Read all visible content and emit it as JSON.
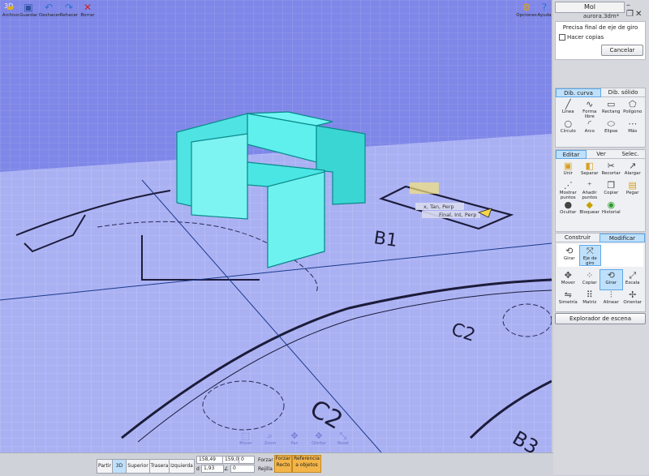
{
  "viewport": {
    "label": "3D",
    "snap_labels": [
      "x, Tan, Perp",
      "Final, Int, Perp"
    ],
    "drawing_labels": [
      "B1",
      "C2",
      "C2",
      "B3"
    ],
    "nav": [
      {
        "icon": "pan-view-icon",
        "label": "Mover"
      },
      {
        "icon": "zoom-icon",
        "label": "Zoom"
      },
      {
        "icon": "pan-icon",
        "label": "Pan"
      },
      {
        "icon": "orbit-icon",
        "label": "Orbitar"
      },
      {
        "icon": "reset-icon",
        "label": "Reset"
      }
    ]
  },
  "panel": {
    "title": "Mol",
    "filename": "aurora.3dm*",
    "prompt": "Precisa final de eje de giro",
    "copy_checkbox": "Hacer copias",
    "cancel": "Cancelar",
    "draw_tabs": [
      "Dib. curva",
      "Dib. sólido"
    ],
    "draw_tools": [
      {
        "icon": "line-icon",
        "label": "Línea"
      },
      {
        "icon": "freeform-icon",
        "label": "Forma libre"
      },
      {
        "icon": "rectangle-icon",
        "label": "Rectang"
      },
      {
        "icon": "polygon-icon",
        "label": "Polígono"
      },
      {
        "icon": "circle-icon",
        "label": "Círculo"
      },
      {
        "icon": "arc-icon",
        "label": "Arco"
      },
      {
        "icon": "ellipse-icon",
        "label": "Elipse"
      },
      {
        "icon": "more-icon",
        "label": "Más"
      }
    ],
    "edit_tabs": [
      "Editar",
      "Ver",
      "Selec."
    ],
    "edit_tools": [
      {
        "icon": "join-icon",
        "label": "Unir"
      },
      {
        "icon": "separate-icon",
        "label": "Separar"
      },
      {
        "icon": "trim-icon",
        "label": "Recortar"
      },
      {
        "icon": "extend-icon",
        "label": "Alargar"
      },
      {
        "icon": "show-points-icon",
        "label": "Mostrar puntos"
      },
      {
        "icon": "add-points-icon",
        "label": "Añadir puntos"
      },
      {
        "icon": "copy-icon",
        "label": "Copiar"
      },
      {
        "icon": "paste-icon",
        "label": "Pegar"
      },
      {
        "icon": "hide-icon",
        "label": "Ocultar"
      },
      {
        "icon": "lock-icon",
        "label": "Bloquear"
      },
      {
        "icon": "history-icon",
        "label": "Historial"
      }
    ],
    "transform_tabs": [
      "Construir",
      "Modificar"
    ],
    "rotate_tools": [
      {
        "icon": "rotate-icon",
        "label": "Girar"
      },
      {
        "icon": "axis-rotate-icon",
        "label": "Eje de giro"
      }
    ],
    "modify_tools": [
      {
        "icon": "move-icon",
        "label": "Mover"
      },
      {
        "icon": "copy-transform-icon",
        "label": "Copiar"
      },
      {
        "icon": "rotate-icon",
        "label": "Girar"
      },
      {
        "icon": "scale-icon",
        "label": "Escala"
      },
      {
        "icon": "mirror-icon",
        "label": "Simetría"
      },
      {
        "icon": "array-icon",
        "label": "Matriz"
      },
      {
        "icon": "align-icon",
        "label": "Alinear"
      },
      {
        "icon": "orient-icon",
        "label": "Orientar"
      }
    ],
    "explorer": "Explorador de escena"
  },
  "bottombar": {
    "file": "Archivo",
    "save": "Guardar",
    "undo": "Deshacer",
    "redo": "Rehacer",
    "delete": "Borrar",
    "views": [
      "Partir",
      "3D",
      "Superior",
      "Trasera",
      "Izquierda"
    ],
    "coord_x": "158,49",
    "coord_y": "159,09",
    "coord_z": "0",
    "coord_d_label": "d",
    "coord_d": "1,93",
    "coord_angle_label": "∠",
    "coord_angle": "0",
    "force": "Forzar",
    "grid": "Rejilla",
    "force2": "Forzar",
    "straight": "Recto",
    "ref1": "Referencia",
    "ref2": "a objetos",
    "options": "Opciones",
    "help": "Ayuda"
  }
}
